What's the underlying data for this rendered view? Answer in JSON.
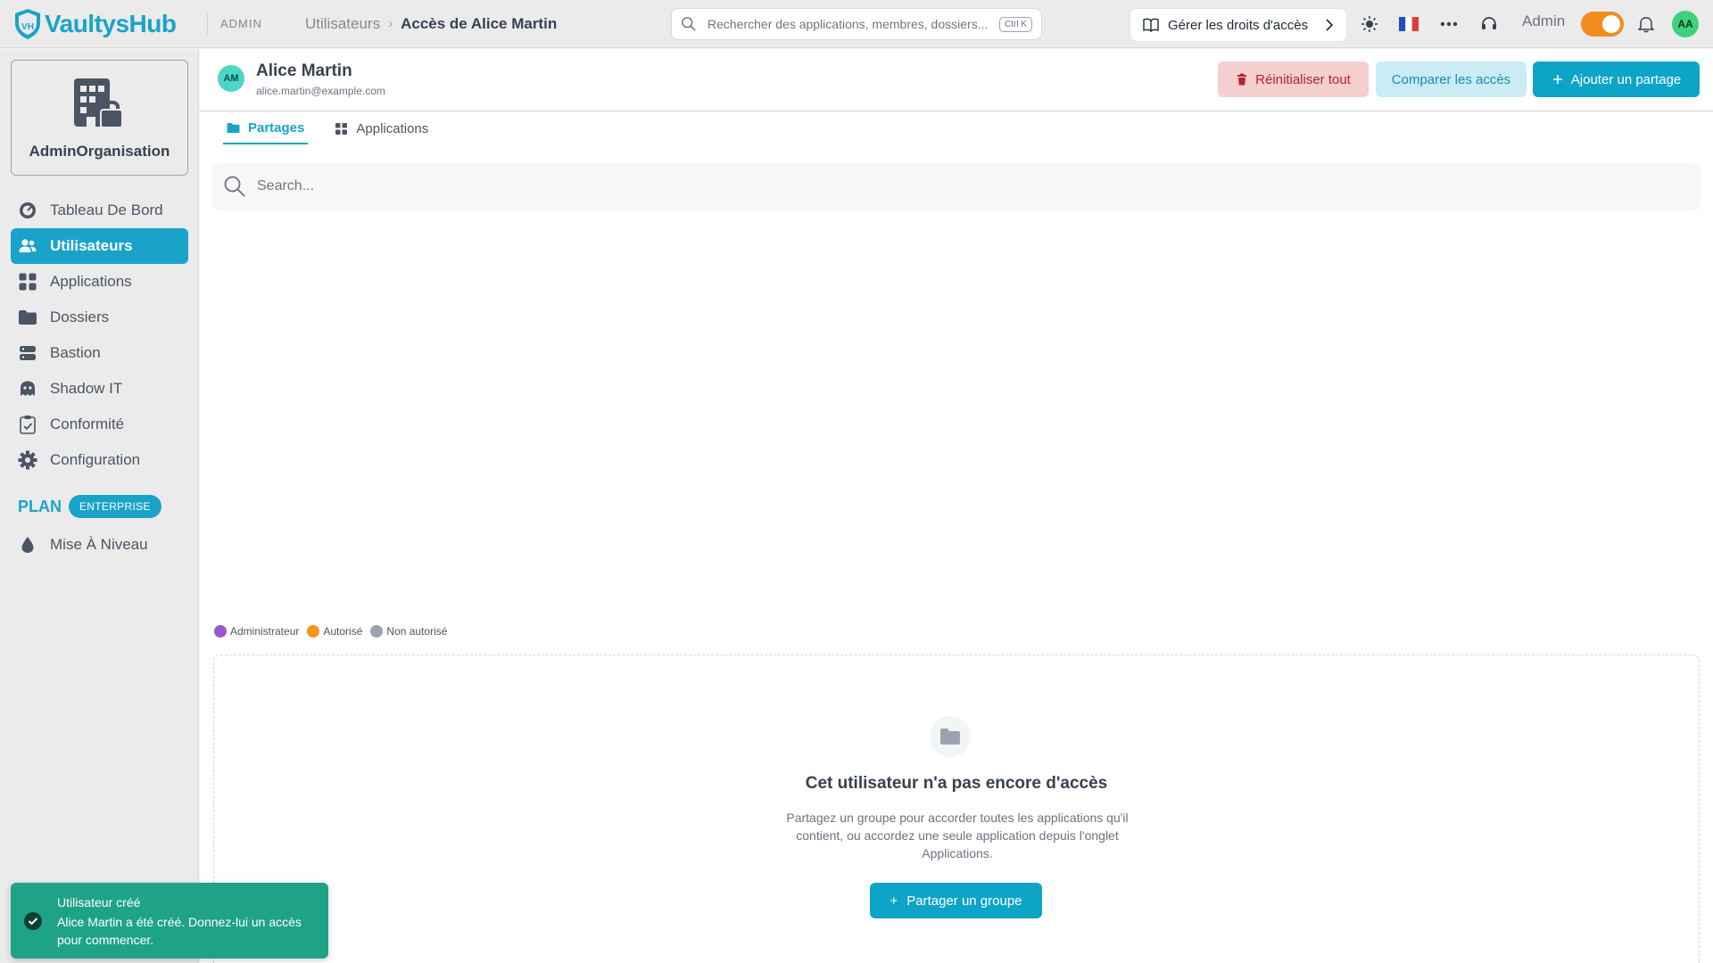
{
  "app": {
    "name": "VaultysHub",
    "area": "ADMIN"
  },
  "breadcrumb": {
    "parent": "Utilisateurs",
    "separator": "›",
    "current": "Accès de Alice Martin"
  },
  "global_search": {
    "placeholder": "Rechercher des applications, membres, dossiers...",
    "shortcut": "Ctrl K"
  },
  "rights_button": {
    "label": "Gérer les droits d'accès"
  },
  "topbar": {
    "admin_label": "Admin",
    "admin_mode_on": true,
    "avatar_initials": "AA",
    "language_flag": "🇫🇷"
  },
  "sidebar": {
    "org_name": "AdminOrganisation",
    "items": [
      {
        "label": "Tableau De Bord",
        "icon": "gauge-icon",
        "active": false
      },
      {
        "label": "Utilisateurs",
        "icon": "users-icon",
        "active": true
      },
      {
        "label": "Applications",
        "icon": "grid-icon",
        "active": false
      },
      {
        "label": "Dossiers",
        "icon": "folder-icon",
        "active": false
      },
      {
        "label": "Bastion",
        "icon": "server-icon",
        "active": false
      },
      {
        "label": "Shadow IT",
        "icon": "ghost-icon",
        "active": false
      },
      {
        "label": "Conformité",
        "icon": "clipboard-check-icon",
        "active": false
      },
      {
        "label": "Configuration",
        "icon": "gear-icon",
        "active": false
      }
    ],
    "plan_label": "PLAN",
    "plan_badge": "ENTERPRISE",
    "upgrade_label": "Mise À Niveau"
  },
  "user": {
    "initials": "AM",
    "name": "Alice Martin",
    "email": "alice.martin@example.com"
  },
  "actions": {
    "reset": "Réinitialiser tout",
    "compare": "Comparer les accès",
    "add": "Ajouter un partage"
  },
  "tabs": [
    {
      "label": "Partages",
      "active": true
    },
    {
      "label": "Applications",
      "active": false
    }
  ],
  "search": {
    "placeholder": "Search..."
  },
  "legend": [
    {
      "label": "Administrateur",
      "color": "#9b59d0"
    },
    {
      "label": "Autorisé",
      "color": "#f7931e"
    },
    {
      "label": "Non autorisé",
      "color": "#9ca3af"
    }
  ],
  "empty_state": {
    "title": "Cet utilisateur n'a pas encore d'accès",
    "description": "Partagez un groupe pour accorder toutes les applications qu'il contient, ou accordez une seule application depuis l'onglet Applications.",
    "button": "Partager un groupe"
  },
  "toast": {
    "title": "Utilisateur créé",
    "message": "Alice Martin a été créé. Donnez-lui un accès pour commencer."
  },
  "colors": {
    "accent": "#1aa3c9",
    "toast": "#1fa386",
    "danger_bg": "#f6cfcf"
  }
}
